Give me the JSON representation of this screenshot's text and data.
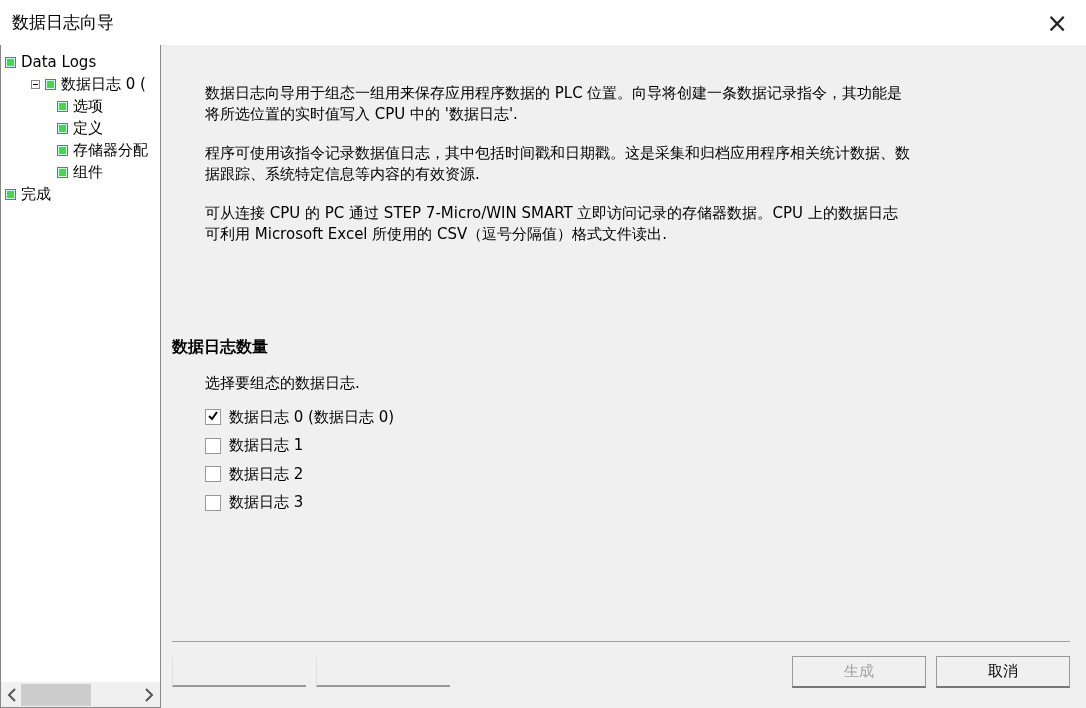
{
  "window": {
    "title": "数据日志向导",
    "close": "×"
  },
  "tree": [
    {
      "label": "Data Logs",
      "children": [
        {
          "label": "数据日志 0 (",
          "expanded": true,
          "children": [
            {
              "label": "选项"
            },
            {
              "label": "定义"
            },
            {
              "label": "存储器分配"
            },
            {
              "label": "组件"
            }
          ]
        }
      ]
    },
    {
      "label": "完成"
    }
  ],
  "intro": [
    "数据日志向导用于组态一组用来保存应用程序数据的 PLC 位置。向导将创建一条数据记录指令，其功能是将所选位置的实时值写入 CPU 中的 '数据日志'.",
    "程序可使用该指令记录数据值日志，其中包括时间戳和日期戳。这是采集和归档应用程序相关统计数据、数据跟踪、系统特定信息等内容的有效资源.",
    "可从连接 CPU 的 PC 通过 STEP 7-Micro/WIN SMART 立即访问记录的存储器数据。CPU 上的数据日志可利用 Microsoft Excel 所使用的 CSV（逗号分隔值）格式文件读出."
  ],
  "section": {
    "heading": "数据日志数量",
    "prompt": "选择要组态的数据日志.",
    "options": [
      {
        "label": "数据日志 0 (数据日志 0)",
        "checked": true
      },
      {
        "label": "数据日志 1",
        "checked": false
      },
      {
        "label": "数据日志 2",
        "checked": false
      },
      {
        "label": "数据日志 3",
        "checked": false
      }
    ]
  },
  "buttons": [
    {
      "label": "生成",
      "disabled": true
    },
    {
      "label": "取消",
      "disabled": false
    }
  ]
}
